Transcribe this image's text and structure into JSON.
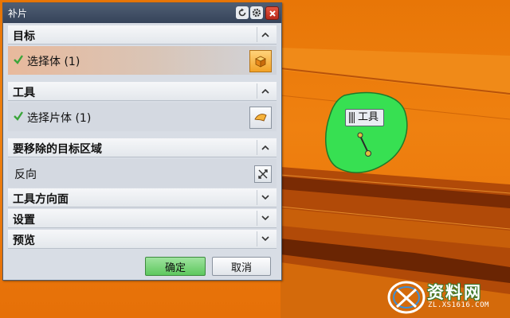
{
  "window": {
    "title": "补片"
  },
  "sections": {
    "target": {
      "header": "目标",
      "row_label": "选择体 (1)"
    },
    "tool": {
      "header": "工具",
      "row_label": "选择片体 (1)"
    },
    "region": {
      "header": "要移除的目标区域",
      "row_label": "反向"
    },
    "tool_direction": {
      "header": "工具方向面"
    },
    "settings": {
      "header": "设置"
    },
    "preview": {
      "header": "预览"
    }
  },
  "buttons": {
    "ok": "确定",
    "cancel": "取消"
  },
  "viewport": {
    "tool_label": "工具"
  },
  "watermark": {
    "title": "资料网",
    "url": "ZL.XS1616.COM"
  },
  "colors": {
    "model_orange": "#e9780b",
    "sheet_green": "#37e052",
    "check_green": "#3aa53a",
    "ok_green": "#5ec85e"
  },
  "icons": {
    "check": "check-icon",
    "select_body": "solid-body-icon",
    "select_sheet": "sheet-body-icon",
    "reverse": "reverse-direction-icon"
  }
}
